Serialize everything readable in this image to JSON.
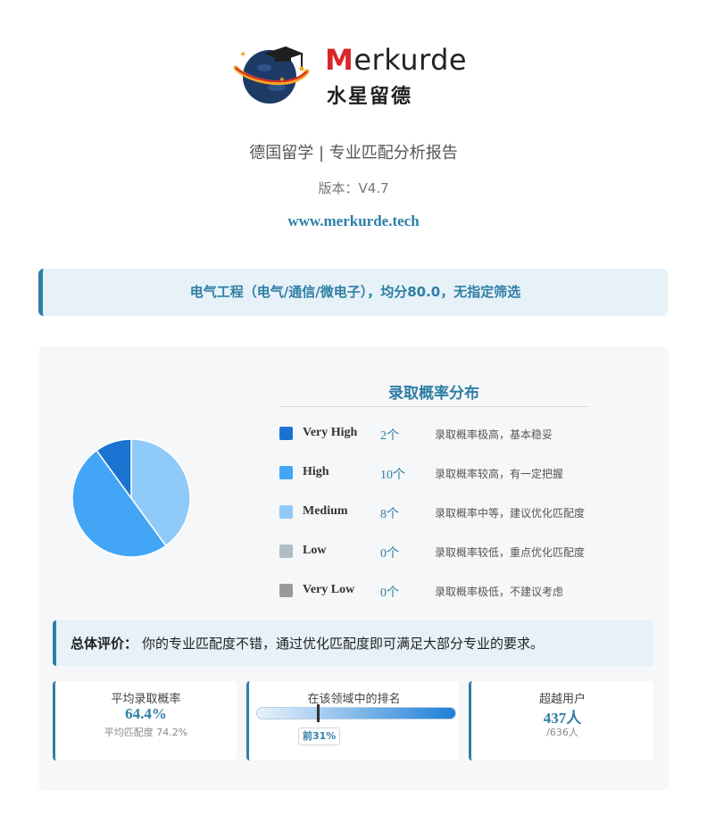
{
  "brand": {
    "name_latin": "Merkurde",
    "name_cn": "水星留德"
  },
  "header": {
    "subtitle": "德国留学 | 专业匹配分析报告",
    "version": "版本：V4.7",
    "website": "www.merkurde.tech"
  },
  "filter": {
    "text": "电气工程（电气/通信/微电子），均分80.0，无指定筛选"
  },
  "distribution": {
    "title": "录取概率分布",
    "items": [
      {
        "name": "Very High",
        "count": "2个",
        "desc": "录取概率极高，基本稳妥",
        "value": 2,
        "color": "#1a73d0"
      },
      {
        "name": "High",
        "count": "10个",
        "desc": "录取概率较高，有一定把握",
        "value": 10,
        "color": "#42a5f5"
      },
      {
        "name": "Medium",
        "count": "8个",
        "desc": "录取概率中等，建议优化匹配度",
        "value": 8,
        "color": "#90caf9"
      },
      {
        "name": "Low",
        "count": "0个",
        "desc": "录取概率较低，重点优化匹配度",
        "value": 0,
        "color": "#b0bec5"
      },
      {
        "name": "Very Low",
        "count": "0个",
        "desc": "录取概率极低，不建议考虑",
        "value": 0,
        "color": "#999999"
      }
    ]
  },
  "chart_data": {
    "type": "pie",
    "categories": [
      "Very High",
      "High",
      "Medium",
      "Low",
      "Very Low"
    ],
    "values": [
      2,
      10,
      8,
      0,
      0
    ],
    "colors": [
      "#1a73d0",
      "#42a5f5",
      "#90caf9",
      "#b0bec5",
      "#999999"
    ]
  },
  "summary": {
    "label": "总体评价：",
    "text": "你的专业匹配度不错，通过优化匹配度即可满足大部分专业的要求。"
  },
  "stats": {
    "avg_prob": {
      "title": "平均录取概率",
      "value": "64.4%",
      "sub": "平均匹配度 74.2%"
    },
    "rank": {
      "title": "在该领域中的排名",
      "label": "前31%",
      "percent": 31
    },
    "surpassed": {
      "title": "超越用户",
      "value": "437人",
      "sub": "/636人"
    }
  }
}
